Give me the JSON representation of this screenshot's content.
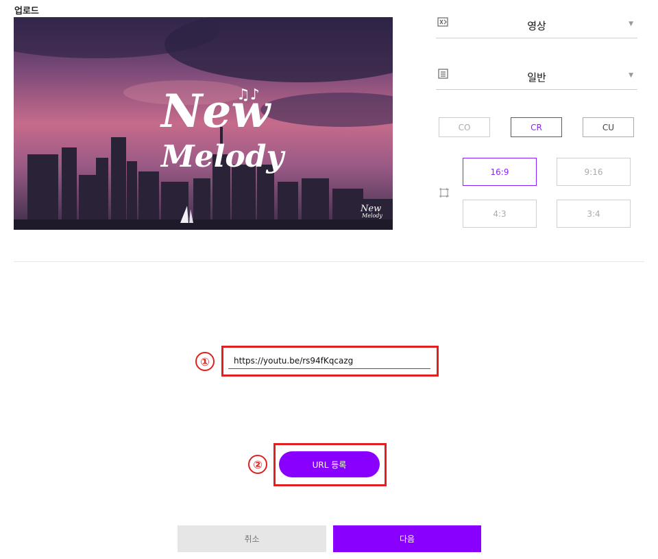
{
  "page": {
    "title": "업로드"
  },
  "preview": {
    "logo_line1": "New",
    "logo_line2": "Melody",
    "watermark_line1": "New",
    "watermark_line2": "Melody"
  },
  "type_select": {
    "value": "영상",
    "icon": "video-type-icon"
  },
  "category_select": {
    "value": "일반",
    "icon": "category-icon"
  },
  "tags": [
    {
      "label": "CO",
      "state": "disabled"
    },
    {
      "label": "CR",
      "state": "selected"
    },
    {
      "label": "CU",
      "state": "normal"
    }
  ],
  "ratios": [
    {
      "label": "16:9",
      "state": "selected"
    },
    {
      "label": "9:16",
      "state": "normal"
    },
    {
      "label": "4:3",
      "state": "normal"
    },
    {
      "label": "3:4",
      "state": "normal"
    }
  ],
  "annotations": {
    "step1": "①",
    "step2": "②"
  },
  "url_input": {
    "value": "https://youtu.be/rs94fKqcazg"
  },
  "url_button": {
    "label": "URL 등록"
  },
  "footer": {
    "cancel_label": "취소",
    "next_label": "다음"
  },
  "colors": {
    "accent": "#8a00ff",
    "highlight": "#e0201f"
  }
}
